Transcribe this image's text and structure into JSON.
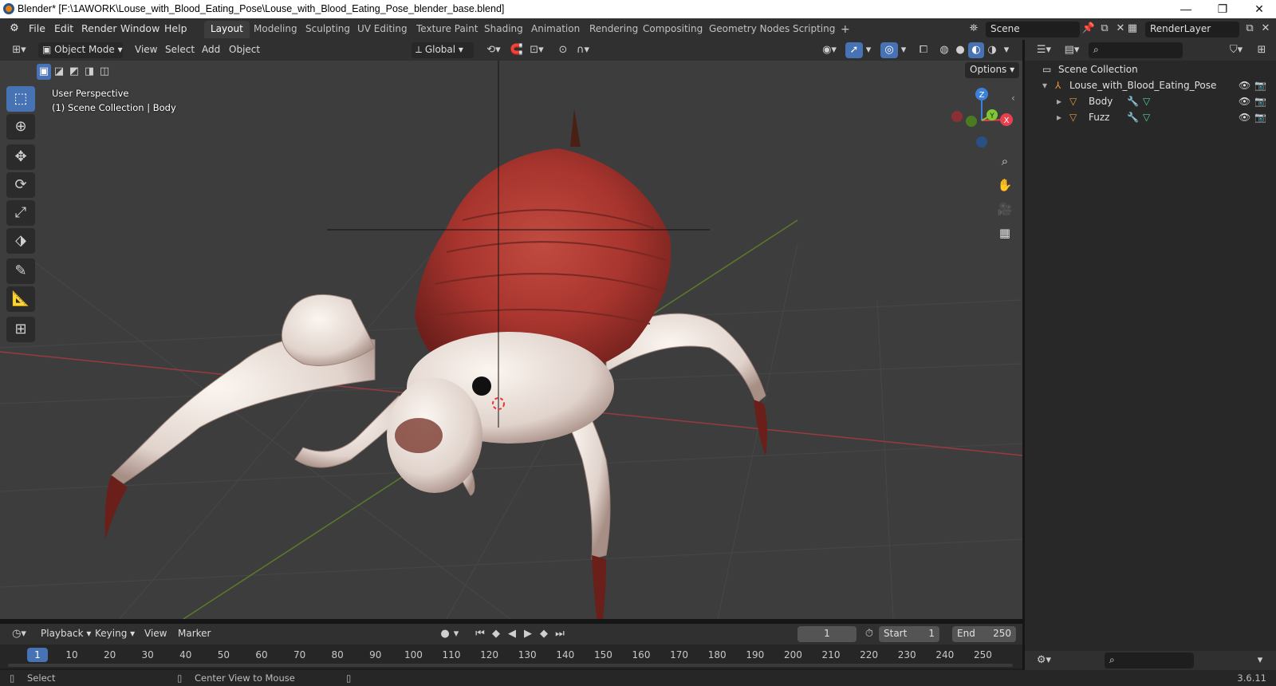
{
  "window": {
    "title": "Blender* [F:\\1AWORK\\Louse_with_Blood_Eating_Pose\\Louse_with_Blood_Eating_Pose_blender_base.blend]",
    "minimize": "—",
    "maximize": "❐",
    "close": "✕"
  },
  "menus": [
    "File",
    "Edit",
    "Render",
    "Window",
    "Help"
  ],
  "workspaces": [
    "Layout",
    "Modeling",
    "Sculpting",
    "UV Editing",
    "Texture Paint",
    "Shading",
    "Animation",
    "Rendering",
    "Compositing",
    "Geometry Nodes",
    "Scripting"
  ],
  "active_workspace": "Layout",
  "add_workspace": "+",
  "scene": {
    "label": "Scene",
    "render_layer": "RenderLayer"
  },
  "viewport_header": {
    "mode": "Object Mode",
    "menus": [
      "View",
      "Select",
      "Add",
      "Object"
    ],
    "orientation": "Global",
    "options": "Options"
  },
  "viewport": {
    "perspective": "User Perspective",
    "collection_info": "(1) Scene Collection | Body",
    "gizmo": {
      "x": "X",
      "y": "Y",
      "z": "Z"
    }
  },
  "outliner": {
    "root": "Scene Collection",
    "items": [
      {
        "label": "Louse_with_Blood_Eating_Pose",
        "level": 1
      },
      {
        "label": "Body",
        "level": 2
      },
      {
        "label": "Fuzz",
        "level": 2
      }
    ]
  },
  "timeline": {
    "menus": [
      "Playback",
      "Keying",
      "View",
      "Marker"
    ],
    "current_frame": "1",
    "start_label": "Start",
    "start": "1",
    "end_label": "End",
    "end": "250",
    "ticks": [
      "10",
      "20",
      "30",
      "40",
      "50",
      "60",
      "70",
      "80",
      "90",
      "100",
      "110",
      "120",
      "130",
      "140",
      "150",
      "160",
      "170",
      "180",
      "190",
      "200",
      "210",
      "220",
      "230",
      "240",
      "250"
    ],
    "cursor": "1"
  },
  "status": {
    "select": "Select",
    "center": "Center View to Mouse",
    "version": "3.6.11"
  },
  "colors": {
    "accent": "#4772b3",
    "x_axis": "#e8414d",
    "y_axis": "#7ec833",
    "z_axis": "#3d80d9"
  }
}
